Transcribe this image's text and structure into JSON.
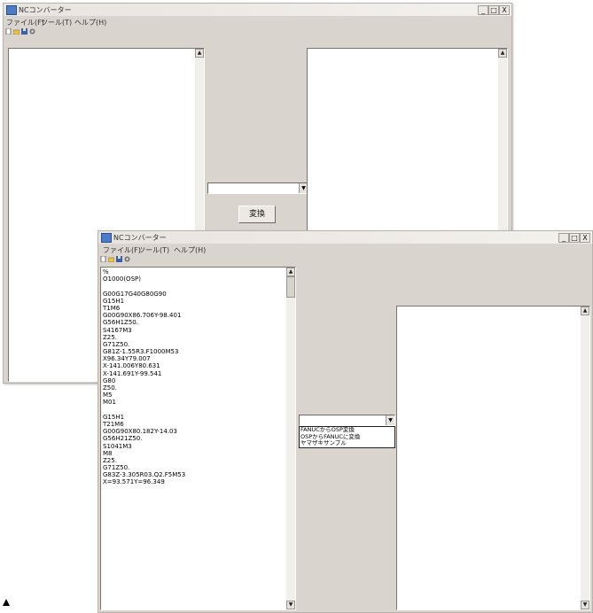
{
  "app": {
    "title": "NCコンバーター"
  },
  "controls": {
    "minimize": "_",
    "maximize": "□",
    "close": "X"
  },
  "menu": {
    "file": "ファイル(F)",
    "tool": "ツール(T)",
    "help": "ヘルプ(H)"
  },
  "toolbar": {
    "icons": [
      "new-file-icon",
      "open-folder-icon",
      "save-icon",
      "settings-icon"
    ]
  },
  "back": {
    "combo_value": "",
    "convert_label": "変換"
  },
  "front": {
    "code_lines": [
      "%",
      "O1000(OSP)",
      "",
      "G00G17G40G80G90",
      "G15H1",
      "T1M6",
      "G00G90X86.706Y-98.401",
      "G56H1Z50.",
      "S4167M3",
      "Z25.",
      "G71Z50.",
      "G81Z-1.55R3.F1000M53",
      "X96.34Y79.007",
      "X-141.006Y80.631",
      "X-141.691Y-99.541",
      "G80",
      "Z50.",
      "M5",
      "M01",
      "",
      "G15H1",
      "T21M6",
      "G00G90X80.182Y-14.03",
      "G56H21Z50.",
      "S1041M3",
      "M8",
      "Z25.",
      "G71Z50.",
      "G83Z-3.305R03.Q2.F5M53",
      "X=93.571Y=96.349"
    ],
    "combo_value": "",
    "dropdown_options": [
      "FANUCからOSP変換",
      "OSPからFANUCに変換",
      "ヤマザキサンプル"
    ]
  },
  "scroll": {
    "up": "▲",
    "down": "▼"
  },
  "combo_arrow": "▼",
  "colors": {
    "window": "#d9d4ce",
    "panel": "#ffffff",
    "app_icon": "#4c7bc8"
  }
}
